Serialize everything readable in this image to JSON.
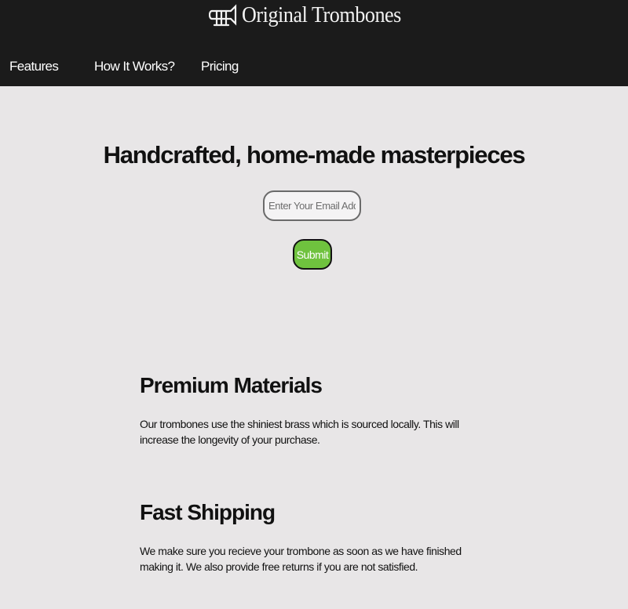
{
  "header": {
    "brand": "Original Trombones",
    "logo_icon": "trombone-logo-icon",
    "background_color": "#1b1b1b",
    "nav": [
      {
        "label": "Features"
      },
      {
        "label": "How It Works?"
      },
      {
        "label": "Pricing"
      }
    ]
  },
  "hero": {
    "title": "Handcrafted, home-made masterpieces",
    "email_placeholder": "Enter Your Email Address",
    "email_value": "",
    "submit_label": "Submit",
    "submit_color": "#6fc23e"
  },
  "features": [
    {
      "title": "Premium Materials",
      "text": "Our trombones use the shiniest brass which is sourced locally. This will increase the longevity of your purchase."
    },
    {
      "title": "Fast Shipping",
      "text": "We make sure you recieve your trombone as soon as we have finished making it. We also provide free returns if you are not satisfied."
    }
  ]
}
